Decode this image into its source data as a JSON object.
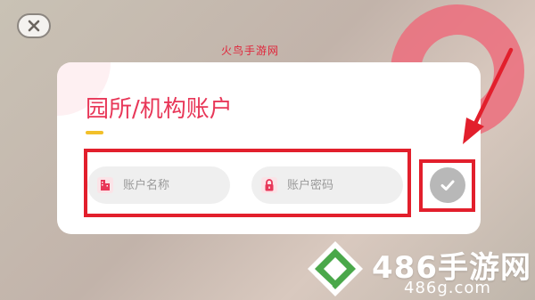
{
  "watermark_top": "火鸟手游网",
  "dialog": {
    "title": "园所/机构账户",
    "account_placeholder": "账户名称",
    "password_placeholder": "账户密码"
  },
  "icons": {
    "close": "close-icon",
    "account": "building-icon",
    "password": "lock-icon",
    "confirm": "checkmark-icon",
    "brand": "brand-logo-icon"
  },
  "brand": {
    "name": "486手游网",
    "url": "486g.com"
  },
  "colors": {
    "accent": "#e83758",
    "highlight": "#e21f2c",
    "confirm_bg": "#b8b8b8"
  }
}
